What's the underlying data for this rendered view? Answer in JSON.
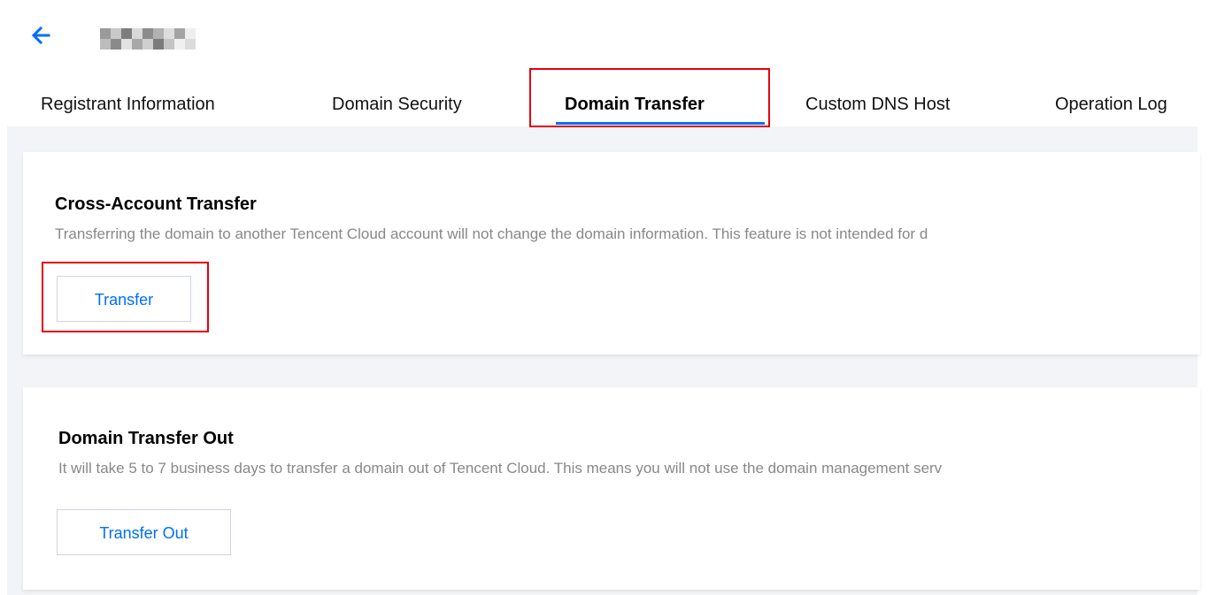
{
  "header": {
    "back_icon": "arrow-left-icon",
    "domain_masked": "pixelated"
  },
  "tabs": [
    {
      "label": "Registrant Information",
      "active": false
    },
    {
      "label": "Domain Security",
      "active": false
    },
    {
      "label": "Domain Transfer",
      "active": true
    },
    {
      "label": "Custom DNS Host",
      "active": false
    },
    {
      "label": "Operation Log",
      "active": false
    }
  ],
  "sections": {
    "cross_account": {
      "title": "Cross-Account Transfer",
      "description": "Transferring the domain to another Tencent Cloud account will not change the domain information. This feature is not intended for d",
      "button_label": "Transfer"
    },
    "transfer_out": {
      "title": "Domain Transfer Out",
      "description": "It will take 5 to 7 business days to transfer a domain out of Tencent Cloud. This means you will not use the domain management serv",
      "button_label": "Transfer Out"
    }
  },
  "colors": {
    "accent": "#006eff",
    "highlight": "#e4000f",
    "page_bg": "#f3f4f7"
  }
}
